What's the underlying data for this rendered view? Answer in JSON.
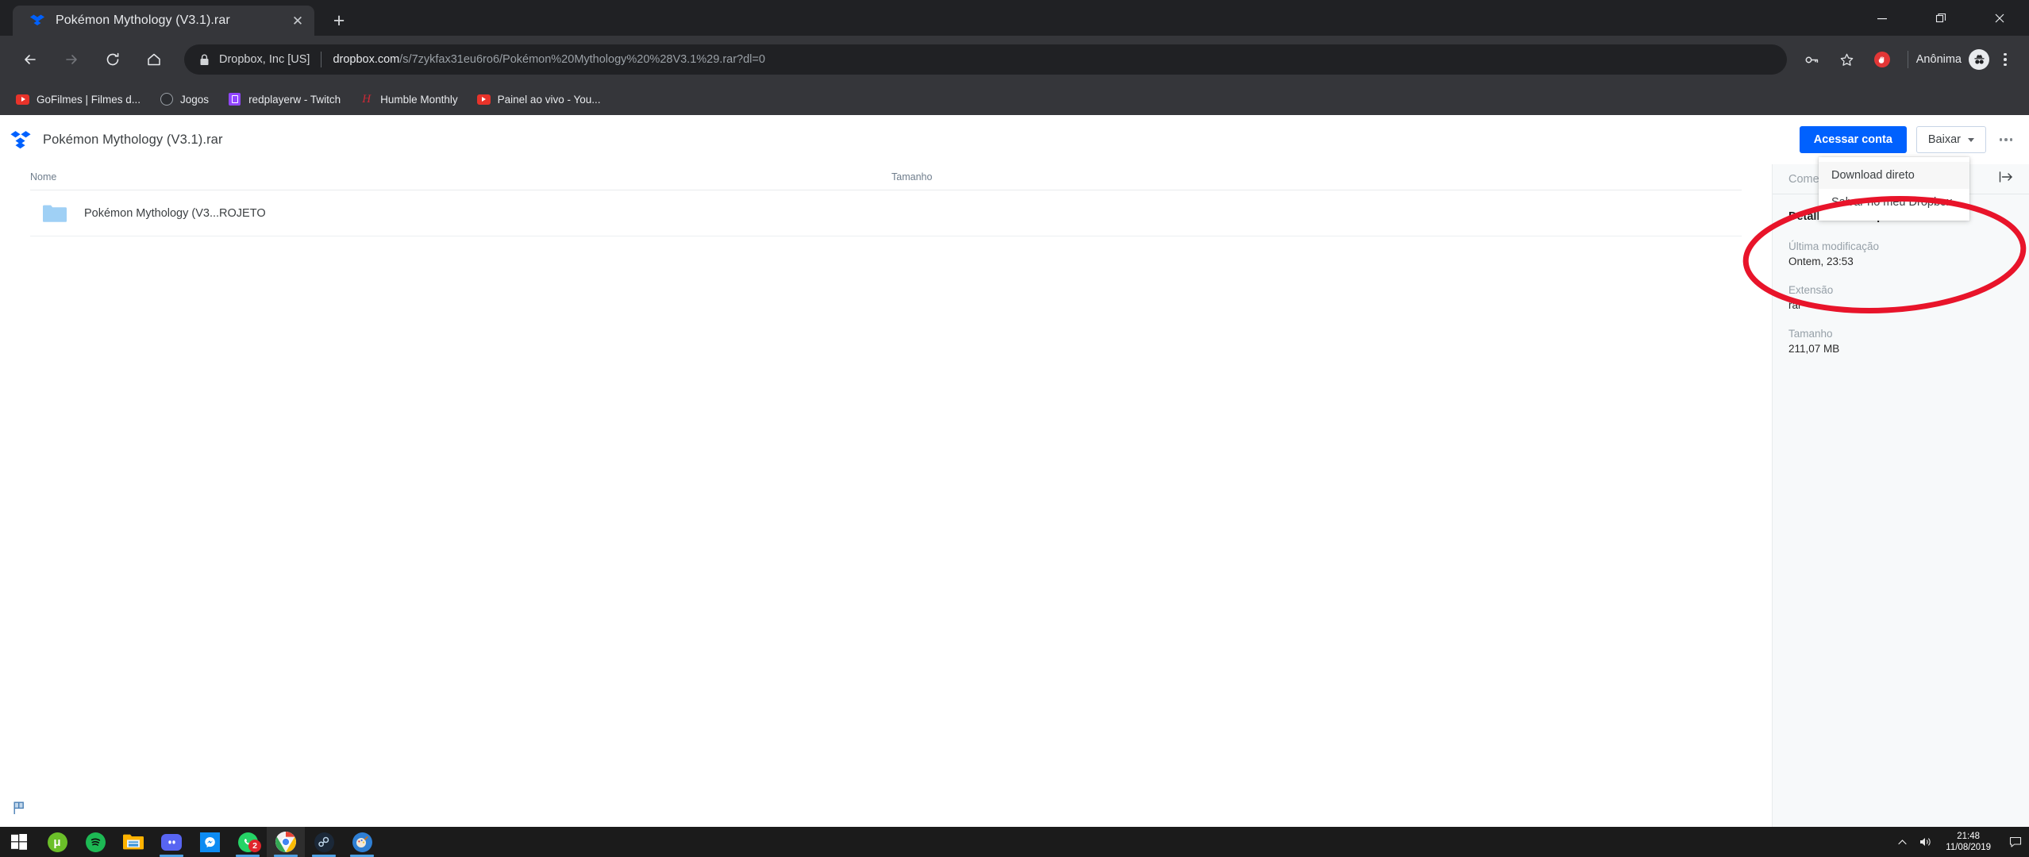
{
  "browser": {
    "tab": {
      "title": "Pokémon Mythology (V3.1).rar",
      "favicon": "dropbox-icon",
      "close_label": "✕"
    },
    "newtab_label": "+",
    "window_controls": {
      "minimize": "minimize-icon",
      "restore": "restore-icon",
      "close": "close-icon"
    },
    "nav": {
      "back": "back-arrow-icon",
      "forward": "forward-arrow-icon",
      "reload": "reload-icon",
      "home": "home-icon"
    },
    "omnibox": {
      "lock": "lock-icon",
      "security_label": "Dropbox, Inc [US]",
      "url_host": "dropbox.com",
      "url_path": "/s/7zykfax31eu6ro6/Pokémon%20Mythology%20%28V3.1%29.rar?dl=0"
    },
    "toolbar_right": {
      "password_icon": "key-icon",
      "bookmark_icon": "star-icon",
      "adblock_icon": "adblock-hand-icon",
      "incognito_label": "Anônima",
      "incognito_icon": "incognito-hat-icon",
      "menu_icon": "three-dot-menu-icon"
    },
    "bookmarks": [
      {
        "label": "GoFilmes | Filmes d...",
        "icon": "youtube-play-icon"
      },
      {
        "label": "Jogos",
        "icon": "folder-circle-icon"
      },
      {
        "label": "redplayerw - Twitch",
        "icon": "twitch-icon"
      },
      {
        "label": "Humble Monthly",
        "icon": "humble-bundle-icon"
      },
      {
        "label": "Painel ao vivo - You...",
        "icon": "youtube-play-icon"
      }
    ]
  },
  "dropbox": {
    "logo": "dropbox-logo",
    "filename": "Pokémon Mythology (V3.1).rar",
    "sign_in_label": "Acessar conta",
    "download_label": "Baixar",
    "more_label": "more-options",
    "dropdown": {
      "items": [
        "Download direto",
        "Salvar no meu Dropbox"
      ]
    },
    "filelist": {
      "columns": {
        "name": "Nome",
        "size": "Tamanho"
      },
      "rows": [
        {
          "icon": "folder-icon",
          "name": "Pokémon Mythology (V3...ROJETO",
          "size": ""
        }
      ]
    },
    "sidebar": {
      "comments_placeholder": "Comentá",
      "collapse_icon": "collapse-panel-icon",
      "details_title": "Detalhes do Dropbox",
      "fields": [
        {
          "label": "Última modificação",
          "value": "Ontem, 23:53"
        },
        {
          "label": "Extensão",
          "value": "rar"
        },
        {
          "label": "Tamanho",
          "value": "211,07 MB"
        }
      ]
    },
    "flag_icon": "report-flag-icon"
  },
  "annotation": {
    "type": "red-ellipse",
    "color": "#e8142a"
  },
  "taskbar": {
    "items": [
      {
        "name": "start-button",
        "icon": "windows-logo-icon",
        "running": false,
        "active": false,
        "badge": ""
      },
      {
        "name": "utorrent",
        "icon": "utorrent-icon",
        "running": false,
        "active": false,
        "badge": ""
      },
      {
        "name": "spotify",
        "icon": "spotify-icon",
        "running": false,
        "active": false,
        "badge": ""
      },
      {
        "name": "file-explorer",
        "icon": "file-explorer-icon",
        "running": false,
        "active": false,
        "badge": ""
      },
      {
        "name": "discord",
        "icon": "discord-icon",
        "running": true,
        "active": false,
        "badge": ""
      },
      {
        "name": "messenger",
        "icon": "messenger-icon",
        "running": false,
        "active": false,
        "badge": ""
      },
      {
        "name": "whatsapp",
        "icon": "whatsapp-icon",
        "running": true,
        "active": false,
        "badge": "2"
      },
      {
        "name": "google-chrome",
        "icon": "chrome-icon",
        "running": true,
        "active": true,
        "badge": ""
      },
      {
        "name": "steam",
        "icon": "steam-icon",
        "running": true,
        "active": false,
        "badge": ""
      },
      {
        "name": "paint",
        "icon": "paint-icon",
        "running": true,
        "active": false,
        "badge": ""
      }
    ],
    "tray": {
      "chevron": "show-hidden-icons-icon",
      "volume": "volume-icon",
      "time": "21:48",
      "date": "11/08/2019",
      "notifications": "action-center-icon"
    }
  }
}
